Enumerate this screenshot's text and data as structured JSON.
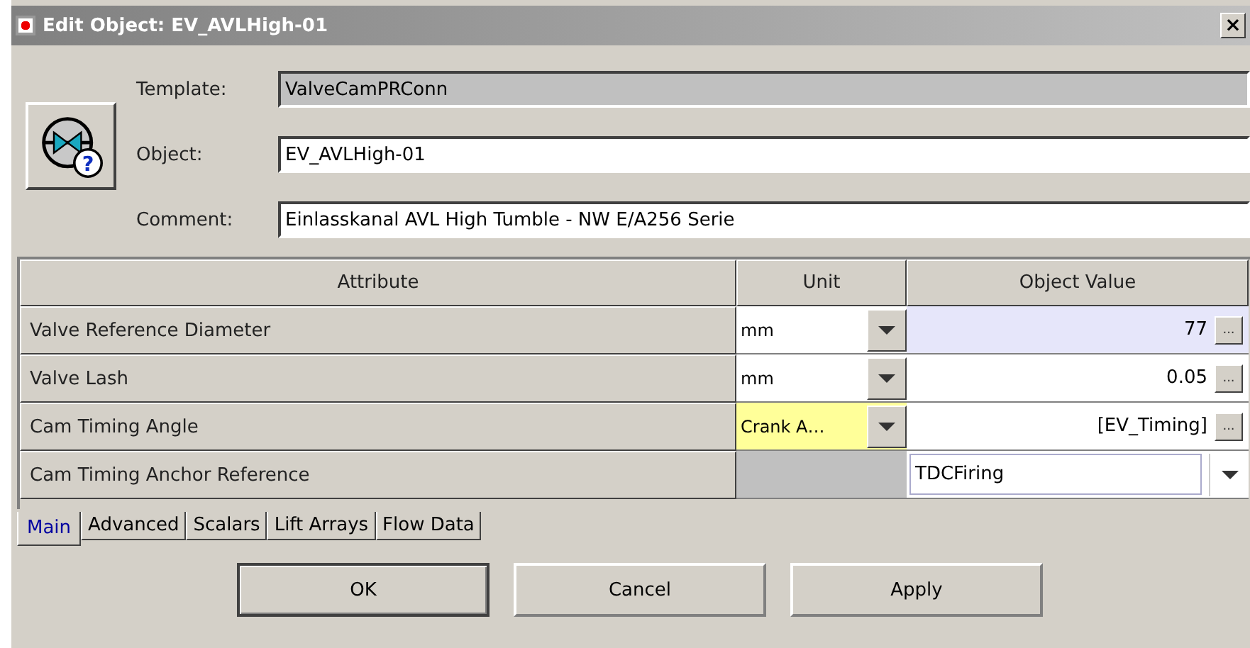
{
  "window": {
    "title": "Edit Object: EV_AVLHigh-01",
    "close": "×"
  },
  "object_icon": {
    "badge": "?"
  },
  "fields": [
    {
      "label": "Template:",
      "value": "ValveCamPRConn",
      "disabled": true
    },
    {
      "label": "Object:",
      "value": "EV_AVLHigh-01",
      "disabled": false
    },
    {
      "label": "Comment:",
      "value": "Einlasskanal AVL High Tumble - NW E/A256 Serie",
      "disabled": false
    }
  ],
  "table": {
    "columns": [
      "Attribute",
      "Unit",
      "Object Value"
    ],
    "rows": [
      {
        "attribute": "Valve Reference Diameter",
        "unit": {
          "text": "mm",
          "highlighted": false
        },
        "kind": "value",
        "value": "77",
        "selected": true,
        "more": "..."
      },
      {
        "attribute": "Valve Lash",
        "unit": {
          "text": "mm",
          "highlighted": false
        },
        "kind": "value",
        "value": "0.05",
        "selected": false,
        "more": "..."
      },
      {
        "attribute": "Cam Timing Angle",
        "unit": {
          "text": "Crank A…",
          "highlighted": true
        },
        "kind": "value",
        "value": "[EV_Timing]",
        "selected": false,
        "more": "..."
      },
      {
        "attribute": "Cam Timing Anchor Reference",
        "kind": "dropdown",
        "value": "TDCFiring",
        "selected": false
      }
    ]
  },
  "tabs": [
    {
      "label": "Main",
      "selected": true
    },
    {
      "label": "Advanced",
      "selected": false
    },
    {
      "label": "Scalars",
      "selected": false
    },
    {
      "label": "Lift Arrays",
      "selected": false
    },
    {
      "label": "Flow Data",
      "selected": false
    }
  ],
  "buttons": [
    {
      "label": "OK",
      "default": true
    },
    {
      "label": "Cancel",
      "default": false
    },
    {
      "label": "Apply",
      "default": false
    }
  ]
}
